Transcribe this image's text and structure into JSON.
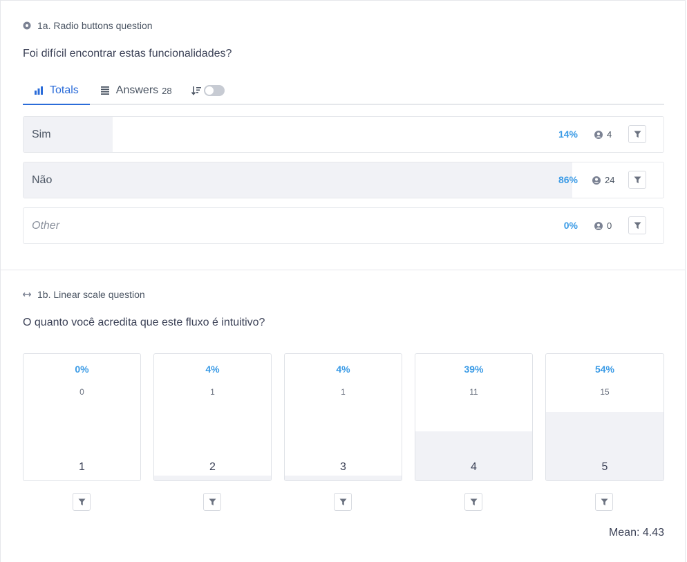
{
  "q1": {
    "type_label": "1a. Radio buttons question",
    "type_icon": "radio-icon",
    "question": "Foi difícil encontrar estas funcionalidades?",
    "tabs": [
      {
        "label": "Totals",
        "icon": "bar-chart-icon",
        "active": true
      },
      {
        "label": "Answers",
        "icon": "list-icon",
        "count": "28",
        "active": false
      }
    ],
    "sort_icon": "sort-icon",
    "toggle_on": false,
    "options": [
      {
        "label": "Sim",
        "percent": "14%",
        "fraction": 0.14,
        "respondents": "4",
        "other": false
      },
      {
        "label": "Não",
        "percent": "86%",
        "fraction": 0.86,
        "respondents": "24",
        "other": false
      },
      {
        "label": "Other",
        "percent": "0%",
        "fraction": 0.0,
        "respondents": "0",
        "other": true
      }
    ]
  },
  "q2": {
    "type_label": "1b. Linear scale question",
    "type_icon": "arrows-horizontal-icon",
    "question": "O quanto você acredita que este fluxo é intuitivo?",
    "scale": [
      {
        "value": "1",
        "percent": "0%",
        "count": "0",
        "fraction": 0.0
      },
      {
        "value": "2",
        "percent": "4%",
        "count": "1",
        "fraction": 0.04
      },
      {
        "value": "3",
        "percent": "4%",
        "count": "1",
        "fraction": 0.04
      },
      {
        "value": "4",
        "percent": "39%",
        "count": "11",
        "fraction": 0.39
      },
      {
        "value": "5",
        "percent": "54%",
        "count": "15",
        "fraction": 0.54
      }
    ],
    "mean_label": "Mean: 4.43"
  },
  "colors": {
    "accent": "#2b6cd9",
    "percent": "#3b9be6",
    "fill": "#f1f2f6",
    "border": "#e5e7eb"
  },
  "icons": {
    "filter": "filter-icon",
    "user": "user-icon"
  }
}
